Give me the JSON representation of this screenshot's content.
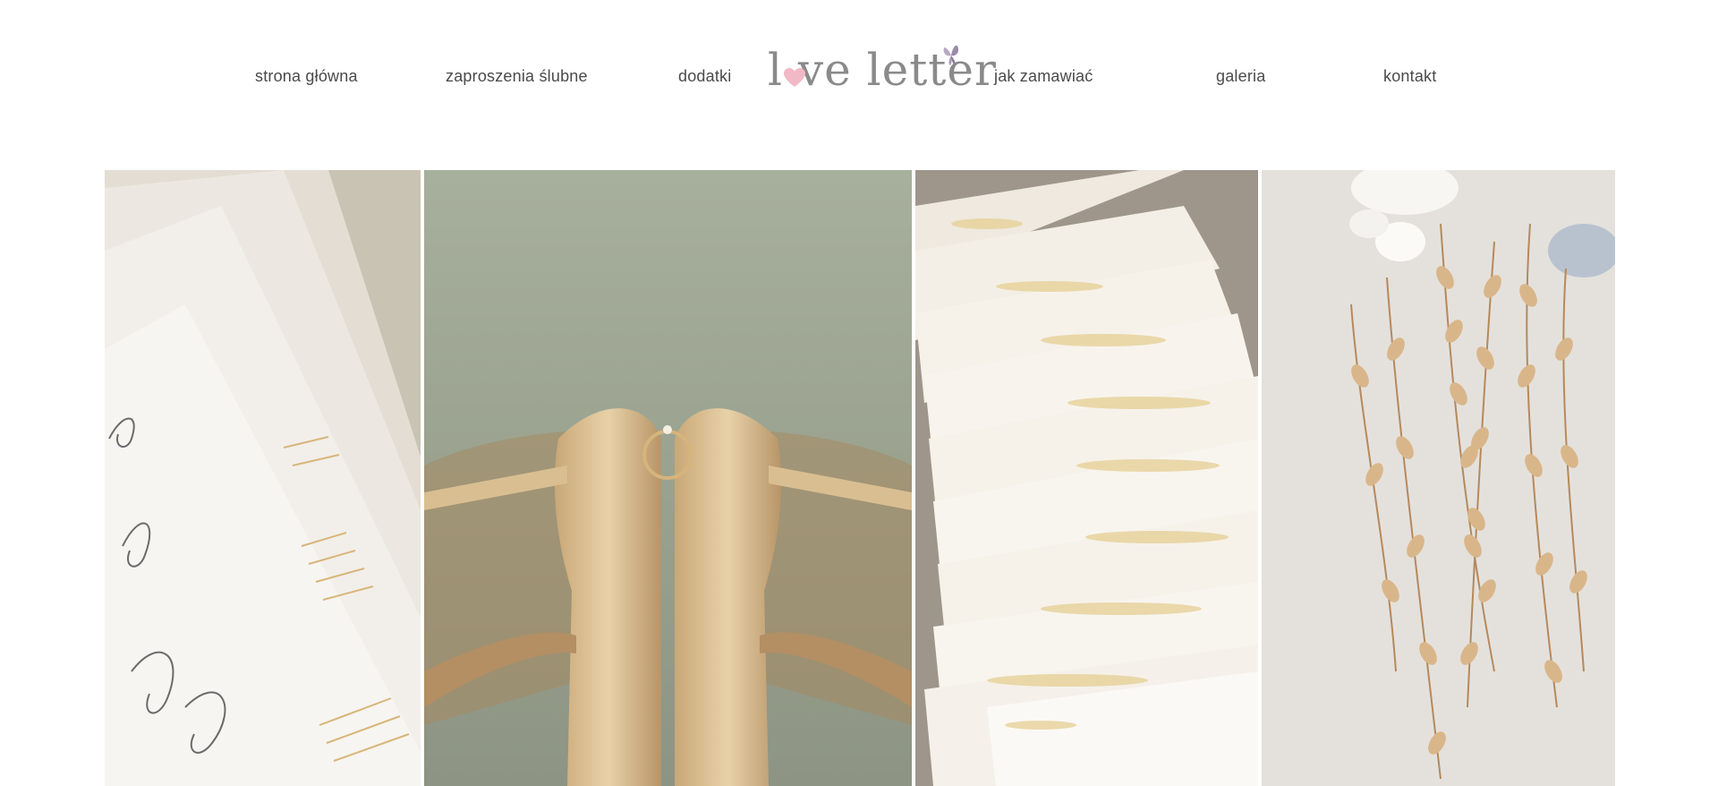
{
  "nav": {
    "home": "strona główna",
    "invitations": "zaproszenia ślubne",
    "extras": "dodatki",
    "how_to_order": "jak zamawiać",
    "gallery": "galeria",
    "contact": "kontakt"
  },
  "logo": {
    "text": "l ve letter",
    "heart_color": "#f2b8c6",
    "butterfly_color": "#9a8ba8"
  },
  "gallery": {
    "images": [
      {
        "subject": "calligraphy invitation cards with gold foil lines",
        "icon": "image-icon"
      },
      {
        "subject": "gold glitter wedding shoes with engagement ring",
        "icon": "image-icon"
      },
      {
        "subject": "fanned envelopes with gold leaf vellum",
        "icon": "image-icon"
      },
      {
        "subject": "gilded ruscus foliage with white flowers",
        "icon": "image-icon"
      }
    ]
  },
  "colors": {
    "background": "#ffffff",
    "nav_text": "#4a4a4a",
    "gold": "#d9b98a"
  }
}
